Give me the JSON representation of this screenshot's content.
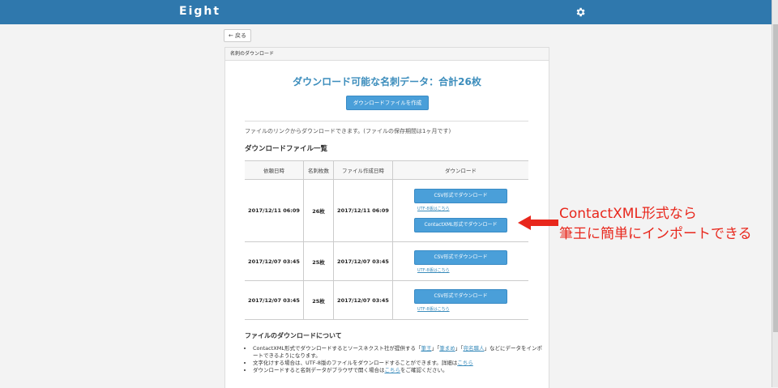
{
  "app": {
    "logo": "Eight"
  },
  "nav": {
    "back_label": "← 戻る"
  },
  "panel": {
    "title": "名刺のダウンロード"
  },
  "main": {
    "headline": "ダウンロード可能な名刺データ：合計26枚",
    "create_button": "ダウンロードファイルを作成",
    "note": "ファイルのリンクからダウンロードできます。(ファイルの保存期間は1ヶ月です)",
    "list_title": "ダウンロードファイル一覧"
  },
  "table": {
    "headers": [
      "依頼日時",
      "名刺枚数",
      "ファイル作成日時",
      "ダウンロード"
    ],
    "rows": [
      {
        "requested": "2017/12/11 06:09",
        "count": "26枚",
        "created": "2017/12/11 06:09",
        "csv": "CSV形式でダウンロード",
        "utf8": "UTF-8版はこちら",
        "xml": "ContactXML形式でダウンロード"
      },
      {
        "requested": "2017/12/07 03:45",
        "count": "25枚",
        "created": "2017/12/07 03:45",
        "csv": "CSV形式でダウンロード",
        "utf8": "UTF-8版はこちら"
      },
      {
        "requested": "2017/12/07 03:45",
        "count": "25枚",
        "created": "2017/12/07 03:45",
        "csv": "CSV形式でダウンロード",
        "utf8": "UTF-8版はこちら"
      }
    ]
  },
  "about": {
    "title": "ファイルのダウンロードについて",
    "item1_a": "ContactXML形式でダウンロードするとソースネクスト社が提供する「",
    "link_hitsuo": "筆王",
    "item1_b": "」「",
    "link_hitsumame": "筆まめ",
    "item1_c": "」「",
    "link_kaimei": "宛名職人",
    "item1_d": "」などにデータをインポートできるようになります。",
    "item2_a": "文字化けする場合は、UTF-8版のファイルをダウンロードすることができます。詳細は",
    "item2_link": "こちら",
    "item3_a": "ダウンロードすると名刺データがブラウザで開く場合は",
    "item3_link": "こちら",
    "item3_b": "をご確認ください。"
  },
  "annotation": {
    "line1": "ContactXML形式なら",
    "line2": "筆王に簡単にインポートできる",
    "color": "#e8271c"
  },
  "icons": {
    "settings": "gear-icon",
    "pointer": "arrow-left-icon"
  }
}
